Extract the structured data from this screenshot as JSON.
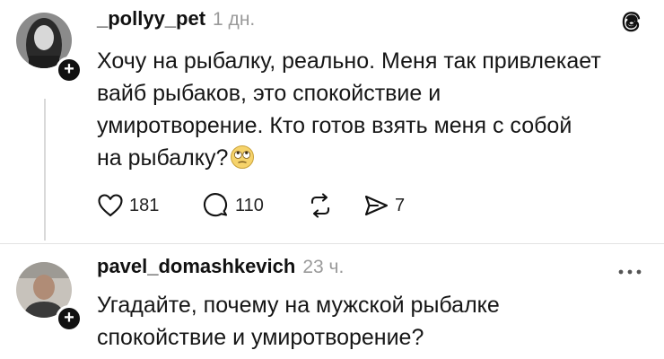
{
  "posts": [
    {
      "username": "_pollyy_pet",
      "time": "1 дн.",
      "text": "Хочу на рыбалку, реально. Меня так привлекает\nвайб рыбаков, это спокойствие и\nумиротворение. Кто готов взять меня с собой\nна рыбалку?",
      "emoji": "face-with-rolling-eyes",
      "likes": "181",
      "replies": "110",
      "shares": "7"
    },
    {
      "username": "pavel_domashkevich",
      "time": "23 ч.",
      "text": "Угадайте, почему на мужской рыбалке\nспокойствие и умиротворение?"
    }
  ],
  "icons": {
    "threads_logo": "threads-logo-icon",
    "more": "more-options-icon",
    "like": "heart-icon",
    "reply": "comment-icon",
    "repost": "repost-icon",
    "share": "send-icon",
    "follow": "plus-icon"
  }
}
